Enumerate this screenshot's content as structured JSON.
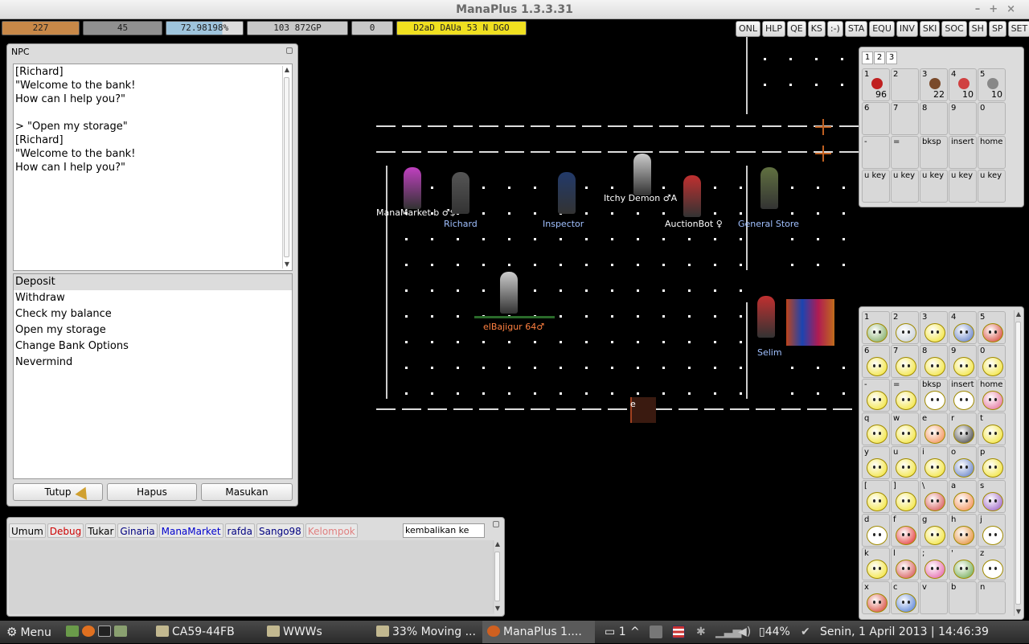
{
  "window": {
    "title": "ManaPlus 1.3.3.31",
    "controls": [
      "–",
      "+",
      "×"
    ]
  },
  "status_bars": [
    {
      "label": "227",
      "color": "#c88848",
      "fill": 1.0
    },
    {
      "label": "45",
      "color": "#909090",
      "fill": 1.0
    },
    {
      "label": "72.98198%",
      "color": "#9ec4dc",
      "fill": 0.73
    },
    {
      "label": "103 872GP",
      "color": "#c8c8c8",
      "fill": 1.0
    },
    {
      "label": "0",
      "color": "#c8c8c8",
      "fill": 1.0
    },
    {
      "label": "D2aD DAUa 53 N DGO",
      "color": "#f0e020",
      "fill": 1.0
    }
  ],
  "top_buttons": [
    "ONL",
    "HLP",
    "QE",
    "KS",
    ":-)",
    "STA",
    "EQU",
    "INV",
    "SKI",
    "SOC",
    "SH",
    "SP",
    "SET"
  ],
  "npc_window": {
    "title": "NPC",
    "text_lines": [
      "[Richard]",
      "\"Welcome to the bank!",
      "How can I help you?\"",
      "",
      "> \"Open my storage\"",
      "[Richard]",
      "\"Welcome to the bank!",
      "How can I help you?\""
    ],
    "menu": [
      "Deposit",
      "Withdraw",
      "Check my balance",
      "Open my storage",
      "Change Bank Options",
      "Nevermind"
    ],
    "selected_index": 0,
    "buttons": {
      "close": "Tutup",
      "clear": "Hapus",
      "submit": "Masukan"
    }
  },
  "chat": {
    "tabs": [
      {
        "label": "Umum",
        "color": "#000000"
      },
      {
        "label": "Debug",
        "color": "#cc0000"
      },
      {
        "label": "Tukar",
        "color": "#000000"
      },
      {
        "label": "Ginaria",
        "color": "#000080"
      },
      {
        "label": "ManaMarket",
        "color": "#0000cc"
      },
      {
        "label": "rafda",
        "color": "#000080"
      },
      {
        "label": "Sango98",
        "color": "#000080"
      },
      {
        "label": "Kelompok",
        "color": "#e08080"
      }
    ],
    "dropdown_value": "kembalikan ke"
  },
  "map": {
    "characters": [
      {
        "name": "ManaMarket b ♂$",
        "color": "#ffffff",
        "kind": "npc"
      },
      {
        "name": "Richard",
        "color": "#a0c0ff",
        "kind": "npc"
      },
      {
        "name": "Inspector",
        "color": "#a0c0ff",
        "kind": "npc"
      },
      {
        "name": "Itchy Demon ♂A",
        "color": "#ffffff",
        "kind": "player"
      },
      {
        "name": "AuctionBot ♀",
        "color": "#ffffff",
        "kind": "player"
      },
      {
        "name": "General Store",
        "color": "#a0c0ff",
        "kind": "npc"
      },
      {
        "name": "elBajigur 64♂",
        "color": "#ff8040",
        "kind": "self"
      },
      {
        "name": "Selim",
        "color": "#a0c0ff",
        "kind": "npc"
      }
    ],
    "door_marker": "e"
  },
  "shortcuts": {
    "tabs": [
      "1",
      "2",
      "3"
    ],
    "slots": [
      {
        "key": "1",
        "qty": "96",
        "icon": "apple-icon",
        "color": "#c02020"
      },
      {
        "key": "2",
        "qty": "",
        "icon": "",
        "color": ""
      },
      {
        "key": "3",
        "qty": "22",
        "icon": "chocolate-bar-icon",
        "color": "#7a4a2a"
      },
      {
        "key": "4",
        "qty": "10",
        "icon": "potion-icon",
        "color": "#d04040"
      },
      {
        "key": "5",
        "qty": "10",
        "icon": "magnifier-icon",
        "color": "#888888"
      },
      {
        "key": "6",
        "qty": "",
        "icon": "",
        "color": ""
      },
      {
        "key": "7",
        "qty": "",
        "icon": "",
        "color": ""
      },
      {
        "key": "8",
        "qty": "",
        "icon": "",
        "color": ""
      },
      {
        "key": "9",
        "qty": "",
        "icon": "",
        "color": ""
      },
      {
        "key": "0",
        "qty": "",
        "icon": "",
        "color": ""
      },
      {
        "key": "-",
        "qty": "",
        "icon": "",
        "color": ""
      },
      {
        "key": "=",
        "qty": "",
        "icon": "",
        "color": ""
      },
      {
        "key": "bksp",
        "qty": "",
        "icon": "",
        "color": ""
      },
      {
        "key": "insert",
        "qty": "",
        "icon": "",
        "color": ""
      },
      {
        "key": "home",
        "qty": "",
        "icon": "",
        "color": ""
      },
      {
        "key": "u key",
        "qty": "",
        "icon": "",
        "color": ""
      },
      {
        "key": "u key",
        "qty": "",
        "icon": "",
        "color": ""
      },
      {
        "key": "u key",
        "qty": "",
        "icon": "",
        "color": ""
      },
      {
        "key": "u key",
        "qty": "",
        "icon": "",
        "color": ""
      },
      {
        "key": "u key",
        "qty": "",
        "icon": "",
        "color": ""
      }
    ]
  },
  "emotes": {
    "keys": [
      "1",
      "2",
      "3",
      "4",
      "5",
      "6",
      "7",
      "8",
      "9",
      "0",
      "-",
      "=",
      "bksp",
      "insert",
      "home",
      "q",
      "w",
      "e",
      "r",
      "t",
      "y",
      "u",
      "i",
      "o",
      "p",
      "[",
      "]",
      "\\",
      "a",
      "s",
      "d",
      "f",
      "g",
      "h",
      "j",
      "k",
      "l",
      ";",
      "'",
      "z",
      "x",
      "c",
      "v",
      "b",
      "n"
    ],
    "colors": [
      "#70a050",
      "#c0c8d0",
      "#f0e020",
      "#5070c0",
      "#d03020",
      "#f0e020",
      "#f0e020",
      "#f0e020",
      "#f0e020",
      "#f0e020",
      "#f0e020",
      "#f0e020",
      "#ffffff",
      "#ffffff",
      "#e06090",
      "#f0e020",
      "#f0e020",
      "#f08040",
      "#303030",
      "#f0e020",
      "#f0e020",
      "#f0e020",
      "#f0e020",
      "#5070c0",
      "#f0e020",
      "#f0e020",
      "#f0e020",
      "#d04040",
      "#f08040",
      "#9050c0",
      "#ffffff",
      "#e02020",
      "#f0e020",
      "#e08020",
      "#ffffff",
      "#f0e020",
      "#d04040",
      "#e050a0",
      "#60a040",
      "#ffffff",
      "#d03020",
      "#4070d0",
      "",
      "",
      ""
    ]
  },
  "taskbar": {
    "menu": "Menu",
    "tasks": [
      "CA59-44FB",
      "WWWs",
      "33% Moving ...",
      "ManaPlus 1...."
    ],
    "notif_count": "1",
    "battery": "44%",
    "clock": "Senin,  1 April 2013 | 14:46:39"
  }
}
